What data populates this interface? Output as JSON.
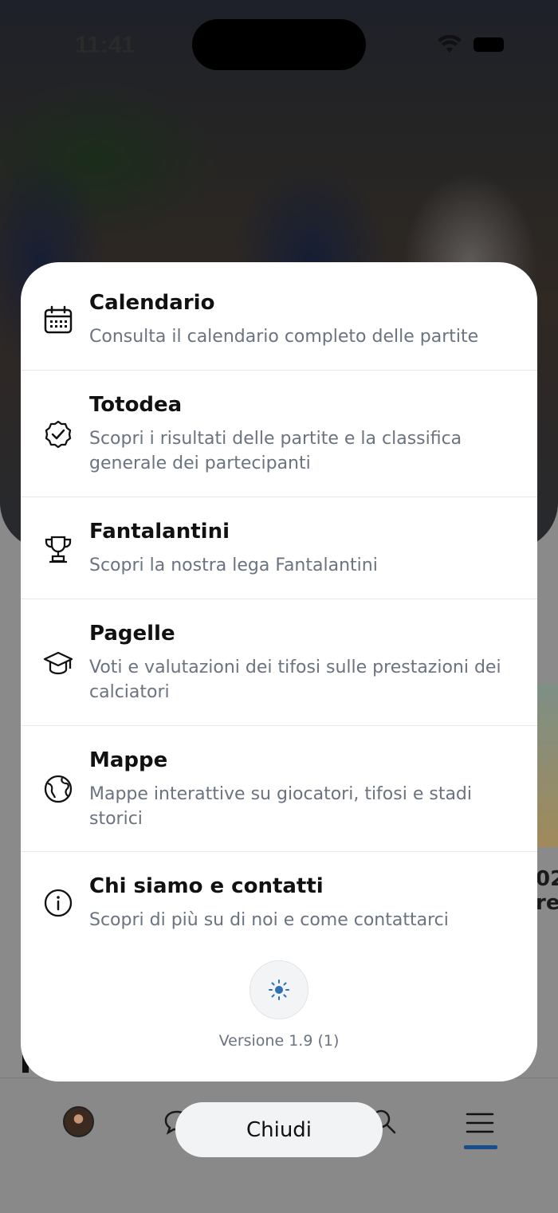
{
  "status_bar": {
    "time": "11:41"
  },
  "background": {
    "side_text_1": "02",
    "side_text_2": "rer"
  },
  "menu": {
    "items": [
      {
        "title": "Calendario",
        "description": "Consulta il calendario completo delle partite",
        "icon": "calendar-icon"
      },
      {
        "title": "Totodea",
        "description": "Scopri i risultati delle partite e la classifica generale dei partecipanti",
        "icon": "check-badge-icon"
      },
      {
        "title": "Fantalantini",
        "description": "Scopri la nostra lega Fantalantini",
        "icon": "trophy-icon"
      },
      {
        "title": "Pagelle",
        "description": "Voti e valutazioni dei tifosi sulle prestazioni dei calciatori",
        "icon": "graduation-cap-icon"
      },
      {
        "title": "Mappe",
        "description": "Mappe interattive su giocatori, tifosi e stadi storici",
        "icon": "globe-icon"
      },
      {
        "title": "Chi siamo e contatti",
        "description": "Scopri di più su di noi e come contattarci",
        "icon": "info-icon"
      }
    ],
    "theme_icon": "sun-icon",
    "version": "Versione 1.9 (1)"
  },
  "close_button": "Chiudi",
  "tabbar": {
    "tabs": [
      "profile-avatar",
      "chat-icon",
      "search-icon",
      "menu-icon"
    ],
    "active": "menu-icon",
    "accent": "#1a4e8a"
  },
  "colors": {
    "sheet": "#ffffff",
    "title": "#111111",
    "description": "#6b7280",
    "sun": "#2e6fb5"
  }
}
